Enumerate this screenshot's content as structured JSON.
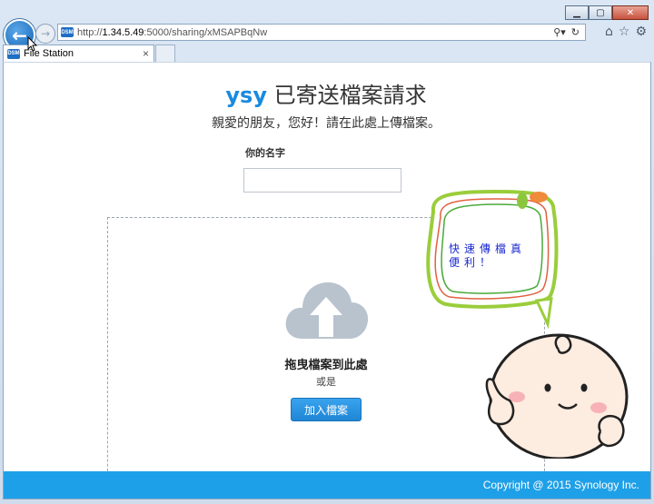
{
  "browser": {
    "url_prefix": "http://",
    "url_host": "1.34.5.49",
    "url_path": ":5000/sharing/xMSAPBqNw",
    "favicon_text": "DSM",
    "tab_title": "File Station",
    "tab_close": "×"
  },
  "page": {
    "title_user": "ysy",
    "title_rest": " 已寄送檔案請求",
    "subtitle": "親愛的朋友，您好！請在此處上傳檔案。",
    "name_label": "你的名字",
    "drop_text": "拖曳檔案到此處",
    "or_text": "或是",
    "add_button": "加入檔案",
    "footer": "Copyright @ 2015 Synology Inc."
  },
  "sticker": {
    "bubble_line1": "快速傳檔真",
    "bubble_line2": "便利！"
  },
  "icons": [
    "back-arrow-icon",
    "forward-arrow-icon",
    "search-icon",
    "refresh-icon",
    "home-icon",
    "star-icon",
    "gear-icon",
    "cloud-upload-icon"
  ],
  "colors": {
    "accent": "#1a8adf",
    "footer": "#1ea0e8",
    "button": "#2a95e2"
  }
}
